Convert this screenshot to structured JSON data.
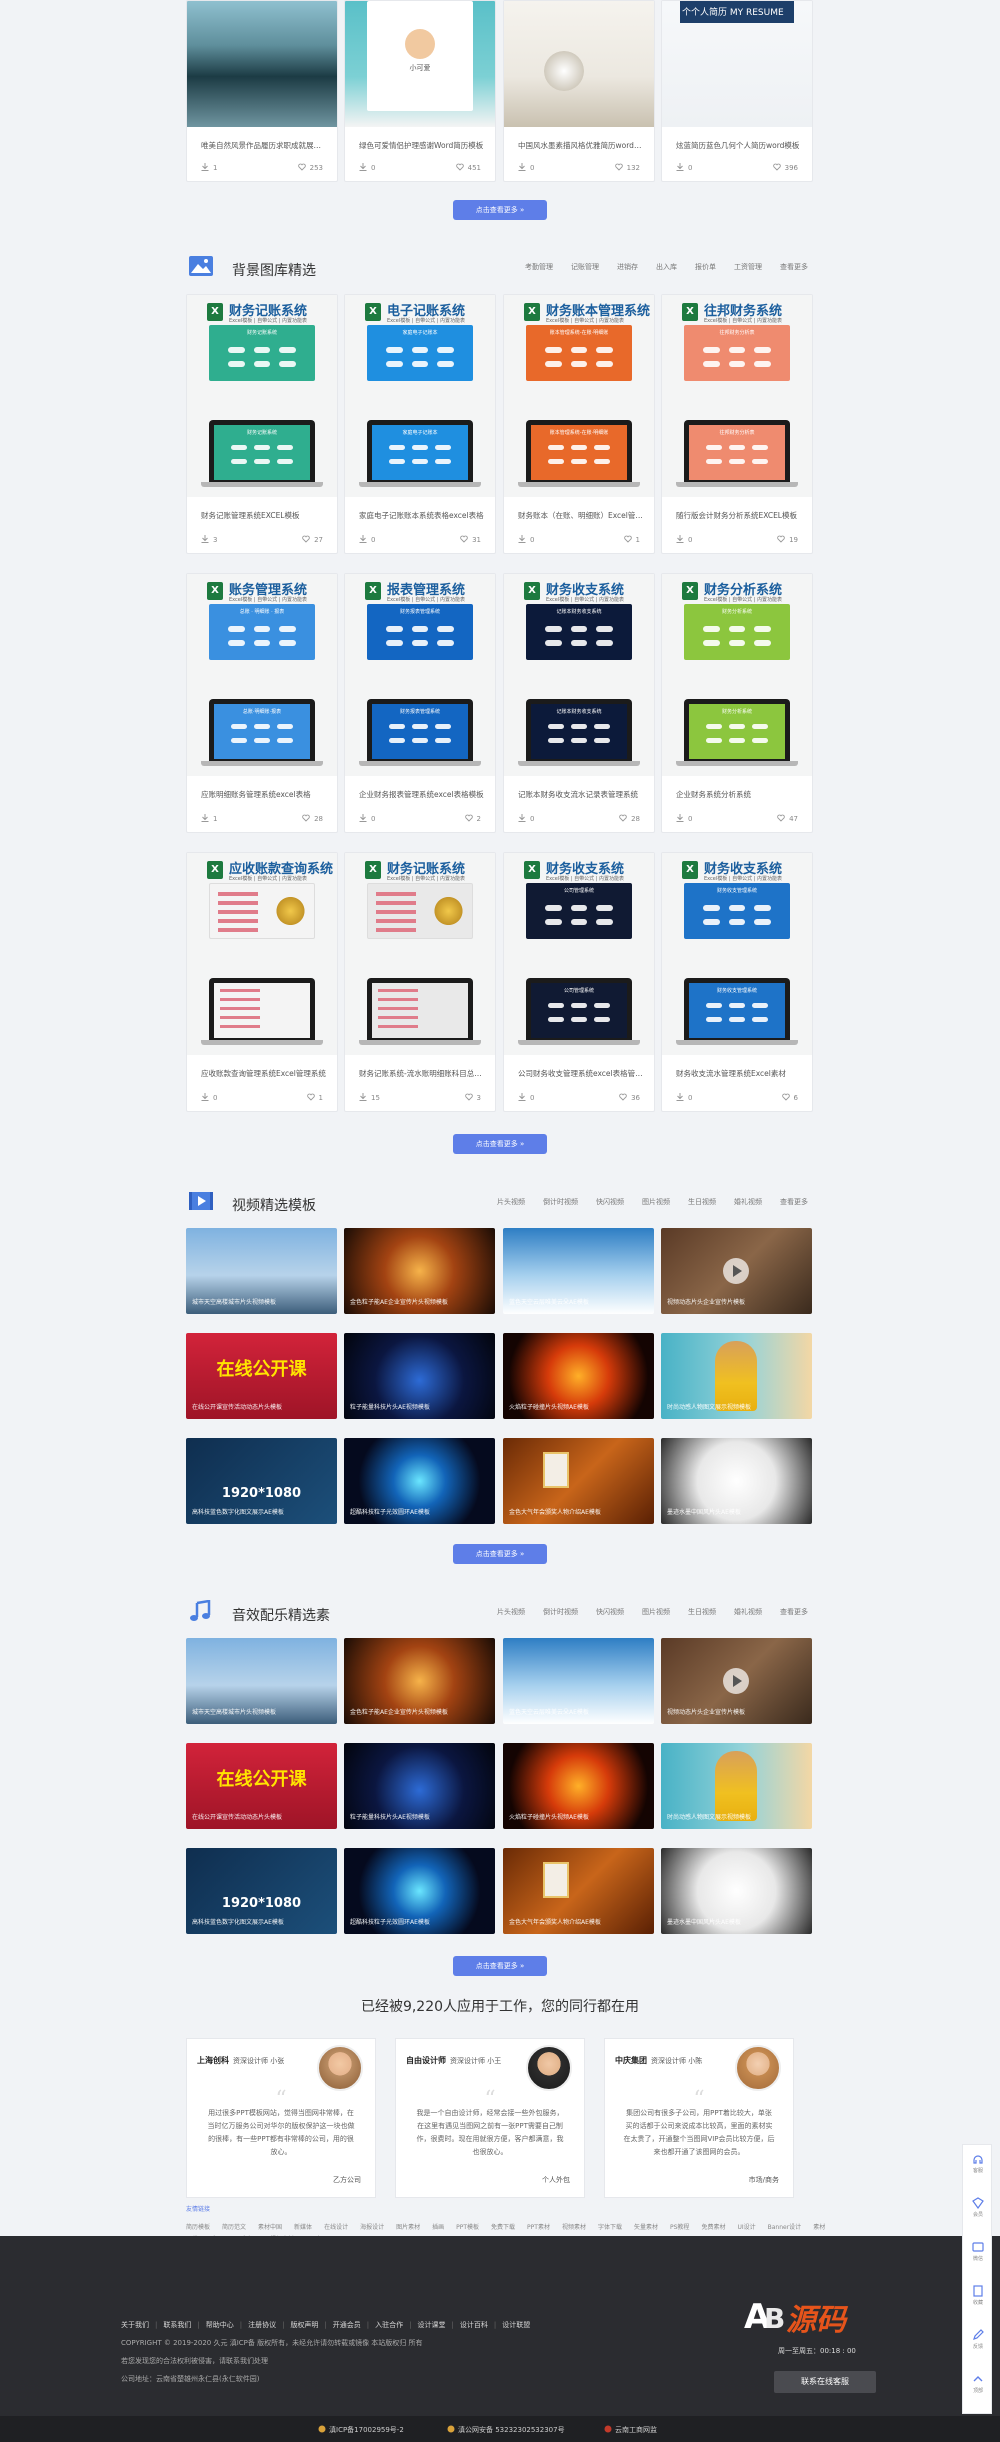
{
  "colors": {
    "accent": "#5e7ee8",
    "footer_bg": "#2b2c30",
    "excel_green": "#1d7a3f"
  },
  "top_cards": [
    {
      "title": "唯美自然风景作品履历求职成就展览...",
      "downloads": "1",
      "likes": "253"
    },
    {
      "title": "绿色可爱情侣护理感谢Word简历模板",
      "downloads": "0",
      "likes": "451"
    },
    {
      "title": "中国风水墨素描风格优雅简历word模板",
      "downloads": "0",
      "likes": "132"
    },
    {
      "title": "炫蓝简历蓝色几何个人简历word模板",
      "downloads": "0",
      "likes": "396"
    }
  ],
  "top_cards_text": [
    "个人简历",
    "小可爱",
    "个个人简历 MY RESUME"
  ],
  "more_label": "点击查看更多 »",
  "bg_section": {
    "title": "背景图库精选",
    "tabs": [
      "考勤管理",
      "记账管理",
      "进销存",
      "出入库",
      "报价单",
      "工资管理",
      "查看更多"
    ],
    "cards": [
      {
        "name": "财务记账系统",
        "title": "财务记账管理系统EXCEL模板",
        "downloads": "3",
        "likes": "27",
        "color": "#2fae8f",
        "sub": "Excel模板 | 自带公式 | 内置功能表",
        "panel": "财务记账系统",
        "scr": "财务记账系统"
      },
      {
        "name": "电子记账系统",
        "title": "家庭电子记账账本系统表格excel表格",
        "downloads": "0",
        "likes": "31",
        "color": "#1f8fe0",
        "sub": "Excel模板 | 自带公式 | 内置功能表",
        "panel": "家庭电子记账本",
        "scr": "家庭电子记账本"
      },
      {
        "name": "财务账本管理系统",
        "title": "财务账本（在账、明细账）Excel管理...",
        "downloads": "0",
        "likes": "1",
        "color": "#e8692a",
        "sub": "Excel模板 | 自带公式 | 内置功能表",
        "panel": "账本管理系统-在账·明细账",
        "scr": "账本管理系统-在账·明细账"
      },
      {
        "name": "往邦财务系统",
        "title": "随行版会计财务分析系统EXCEL模板",
        "downloads": "0",
        "likes": "19",
        "color": "#ef8b6f",
        "sub": "Excel模板 | 自带公式 | 内置功能表",
        "panel": "往邦财务分析表",
        "scr": "往邦财务分析表"
      },
      {
        "name": "账务管理系统",
        "title": "应账明细账务管理系统excel表格",
        "downloads": "1",
        "likes": "28",
        "color": "#3a90e0",
        "sub": "Excel模板 | 自带公式 | 内置功能表",
        "panel": "总账 · 明细账 · 报表",
        "scr": "总账·明细账·报表"
      },
      {
        "name": "报表管理系统",
        "title": "企业财务报表管理系统excel表格模板",
        "downloads": "0",
        "likes": "2",
        "color": "#1366c2",
        "sub": "Excel模板 | 自带公式 | 内置功能表",
        "panel": "财务报表管理系统",
        "scr": "财务报表管理系统"
      },
      {
        "name": "财务收支系统",
        "title": "记账本财务收支流水记录表管理系统",
        "downloads": "0",
        "likes": "28",
        "color": "#0c1a3a",
        "sub": "Excel模板 | 自带公式 | 内置功能表",
        "panel": "记账本财务收支系统",
        "scr": "记账本财务收支系统"
      },
      {
        "name": "财务分析系统",
        "title": "企业财务系统分析系统",
        "downloads": "0",
        "likes": "47",
        "color": "#8cc63e",
        "sub": "Excel模板 | 自带公式 | 内置功能表",
        "panel": "财务分析系统",
        "scr": "财务分析系统"
      },
      {
        "name": "应收账款查询系统",
        "title": "应收账款查询管理系统Excel管理系统",
        "downloads": "0",
        "likes": "1",
        "color": "#f4f4f4",
        "sub": "Excel模板 | 自带公式 | 内置功能表",
        "panel": "",
        "scr": ""
      },
      {
        "name": "财务记账系统",
        "title": "财务记账系统-流水账明细账科目总分...",
        "downloads": "15",
        "likes": "3",
        "color": "#e9e9e9",
        "sub": "Excel模板 | 自带公式 | 内置功能表",
        "panel": "",
        "scr": ""
      },
      {
        "name": "财务收支系统",
        "title": "公司财务收支管理系统excel表格管理...",
        "downloads": "0",
        "likes": "36",
        "color": "#101a33",
        "sub": "Excel模板 | 自带公式 | 内置功能表",
        "panel": "公司管理系统",
        "scr": "公司管理系统"
      },
      {
        "name": "财务收支系统",
        "title": "财务收支流水管理系统Excel素材",
        "downloads": "0",
        "likes": "6",
        "color": "#1e73c8",
        "sub": "Excel模板 | 自带公式 | 内置功能表",
        "panel": "财务收支管理系统",
        "scr": "财务收支管理系统"
      }
    ]
  },
  "video_section": {
    "title": "视频精选模板",
    "tabs": [
      "片头视频",
      "倒计时视频",
      "快闪视频",
      "图片视频",
      "生日视频",
      "婚礼视频",
      "查看更多"
    ],
    "tiles": [
      {
        "cap": "城市天空高楼城市片头视频模板",
        "bg": "linear-gradient(180deg,#7fb2e0 0%,#b7d3ea 55%,#3c5d7a 100%)",
        "big": "",
        "bigc": "#fff"
      },
      {
        "cap": "金色粒子能AE企业宣传片头视频模板",
        "bg": "radial-gradient(circle at 50% 50%,#f6b34a 0%,#a34312 40%,#1a0c05 100%)",
        "big": "",
        "bigc": "#fff"
      },
      {
        "cap": "蓝色天空云层唯美云朵AE模板",
        "bg": "linear-gradient(180deg,#2e7ec4 0%,#a6d0ee 55%,#ffffff 100%)",
        "big": "",
        "bigc": "#fff"
      },
      {
        "cap": "视频动态片头企业宣传片模板",
        "bg": "linear-gradient(135deg,#5a3a26 0%,#8a6648 50%,#3a2a1d 100%)",
        "big": "",
        "bigc": "#fff"
      },
      {
        "cap": "在线公开课宣传活动动态片头模板",
        "bg": "linear-gradient(180deg,#d2233a 0%,#9e1427 100%)",
        "big": "在线公开课",
        "bigc": "#ffe400"
      },
      {
        "cap": "粒子能量科技片头AE视频模板",
        "bg": "radial-gradient(circle at 50% 55%,#2d6bd6 0%,#0b1640 50%,#02040c 100%)",
        "big": "",
        "bigc": "#fff"
      },
      {
        "cap": "火焰粒子碰撞片头视频AE模板",
        "bg": "radial-gradient(circle at 50% 50%,#ffb028 0%,#d63b0a 35%,#140402 80%)",
        "big": "",
        "bigc": "#fff"
      },
      {
        "cap": "时尚动感人物图文展示视频模板",
        "bg": "linear-gradient(90deg,#48b2c6 0%,#95d3d9 55%,#f3d7a5 100%)",
        "big": "",
        "bigc": "#fff"
      },
      {
        "cap": "高科技蓝色数字化图文展示AE模板",
        "bg": "linear-gradient(135deg,#0f2e4f 0%,#1c4f7a 100%)",
        "big": "1920*1080",
        "bigc": "#ffffff"
      },
      {
        "cap": "超酷科技粒子光效圆环AE模板",
        "bg": "radial-gradient(circle at 50% 50%,#6ae6ff 0%,#1264b8 30%,#050a1e 70%)",
        "big": "",
        "bigc": "#fff"
      },
      {
        "cap": "金色大气年会颁奖人物介绍AE模板",
        "bg": "linear-gradient(135deg,#6a2a06 0%,#c8651a 50%,#5a2004 100%)",
        "big": "",
        "bigc": "#fff"
      },
      {
        "cap": "墨迹水墨中国风片头AE模板",
        "bg": "radial-gradient(circle at 50% 50%,#ffffff 0%,#e8e8e8 45%,#2a2a2a 100%)",
        "big": "",
        "bigc": "#222"
      }
    ]
  },
  "music_section": {
    "title": "音效配乐精选素",
    "tabs": [
      "片头视频",
      "倒计时视频",
      "快闪视频",
      "图片视频",
      "生日视频",
      "婚礼视频",
      "查看更多"
    ]
  },
  "testimonials": {
    "heading": "已经被9,220人应用于工作，您的同行都在用",
    "items": [
      {
        "company": "上海创科",
        "who": "资深设计师 小张",
        "text": "用过很多PPT模板网站，觉得当图网非常棒，在当时亿万服务公司对华尔的版权保护这一块也做的很棒，有一些PPT都有非常棒的公司，用的很放心。",
        "sig": "乙方公司"
      },
      {
        "company": "自由设计师",
        "who": "资深设计师 小王",
        "text": "我是一个自由设计师，经常会接一些外包服务，在这里有遇见当图网之前有一张PPT需要自己制作，很费时。现在用就很方便，客户都满意，我也很放心。",
        "sig": "个人外包"
      },
      {
        "company": "中庆集团",
        "who": "资深设计师 小陈",
        "text": "集团公司有很多子公司，用PPT着比较大，单张买的话都于公司来说成本比较高，里面的素材实在太贵了，开通整个当图网VIP会员比较方便，后来也都开通了该图网的会员。",
        "sig": "市场/商务"
      }
    ]
  },
  "friend_links": {
    "label": "友情链接",
    "row1": [
      "简历模板",
      "简历范文",
      "素材中国",
      "新媒体",
      "在线设计",
      "海报设计",
      "图片素材",
      "插画",
      "PPT模板",
      "免费下载",
      "PPT素材",
      "视频素材",
      "字体下载",
      "矢量素材",
      "PS教程",
      "免费素材",
      "UI设计",
      "Banner设计",
      "素材下载",
      "千图网",
      "千库网"
    ],
    "row2": [
      "视频素材",
      "VIP会员"
    ]
  },
  "footer": {
    "nav": [
      "关于我们",
      "联系我们",
      "帮助中心",
      "注册协议",
      "版权声明",
      "开通会员",
      "入驻合作",
      "设计课堂",
      "设计百科",
      "设计联盟"
    ],
    "copyright": "COPYRIGHT © 2019-2020 久元 滇ICP备 版权所有，未经允许请勿转载或镜像 本站版权归 所有",
    "line2": "若您发现您的合法权利被侵害，请联系我们处理",
    "line3": "公司地址：云南省楚雄州永仁县(永仁软件园)",
    "logo_text": "AB源码",
    "hours": "周一至周五：00:18 : 00",
    "contact_btn": "联系在线客服",
    "icp": "滇ICP备17002959号-2",
    "police": "滇公网安备 53232302532307号",
    "gov": "云南工商网监"
  },
  "floatbar": [
    "客服",
    "会员",
    "微信",
    "收藏",
    "反馈",
    "顶部"
  ]
}
